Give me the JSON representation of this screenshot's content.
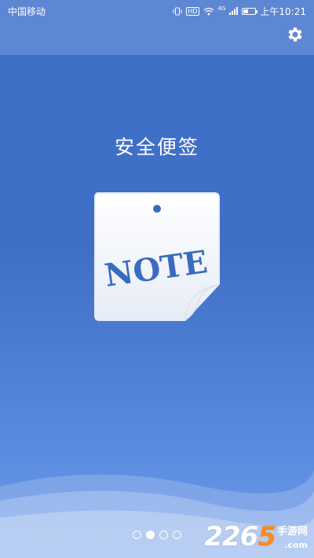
{
  "status_bar": {
    "carrier": "中国移动",
    "hd": "HD",
    "network": "4G",
    "time": "上午10:21"
  },
  "header": {
    "settings_icon": "gear-icon"
  },
  "main": {
    "title": "安全便签",
    "logo_text": "NOTE"
  },
  "pager": {
    "count": 4,
    "active_index": 1
  },
  "watermark": {
    "num_a": "22",
    "num_b": "6",
    "num_c": "5",
    "cn": "手游网",
    "com": ".com"
  },
  "colors": {
    "background": "#3f70c8",
    "note_ink": "#2f5fa8",
    "accent_orange": "#ff8a1e"
  }
}
